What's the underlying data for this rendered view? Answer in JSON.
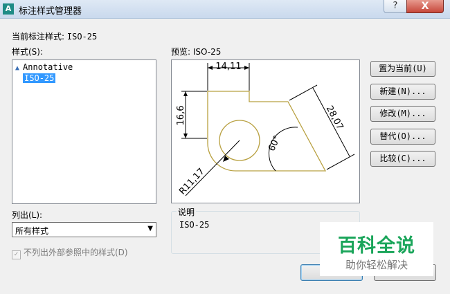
{
  "window": {
    "title": "标注样式管理器",
    "help_glyph": "?",
    "close_glyph": "X",
    "icon_glyph": "A"
  },
  "current_style": {
    "label": "当前标注样式:",
    "value": "ISO-25"
  },
  "styles": {
    "label": "样式(S):",
    "items": [
      {
        "name": "Annotative",
        "annotative": true,
        "selected": false
      },
      {
        "name": "ISO-25",
        "annotative": false,
        "selected": true
      }
    ]
  },
  "preview": {
    "label": "预览: ISO-25",
    "dims": {
      "top_width": "14,11",
      "left_height": "16,6",
      "slant": "28,07",
      "angle": "60°",
      "radius": "R11,17"
    }
  },
  "list_filter": {
    "label": "列出(L):",
    "value": "所有样式"
  },
  "xref_option": {
    "label": "不列出外部参照中的样式(D)",
    "checked": true,
    "enabled": false
  },
  "description": {
    "label": "说明",
    "text": "ISO-25"
  },
  "buttons": {
    "set_current": "置为当前(U)",
    "new": "新建(N)...",
    "modify": "修改(M)...",
    "override": "替代(O)...",
    "compare": "比较(C)..."
  },
  "watermark": {
    "title": "百科全说",
    "subtitle": "助你轻松解决"
  },
  "colors": {
    "selection": "#3399ff",
    "geometry": "#b8a040",
    "dimension": "#000000",
    "watermark": "#1aa55a"
  }
}
